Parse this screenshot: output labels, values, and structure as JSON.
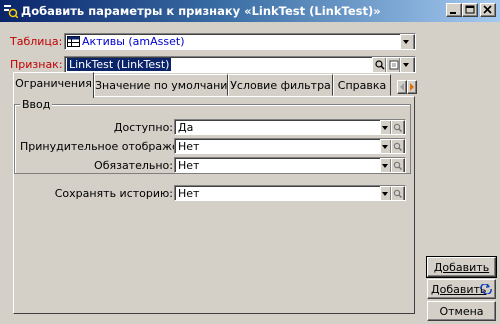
{
  "window": {
    "title": "Добавить параметры к признаку «LinkTest (LinkTest)»",
    "icon": "fields-icon",
    "controls": [
      "minimize",
      "maximize",
      "close"
    ]
  },
  "form": {
    "table_label": "Таблица:",
    "table_value": "Активы (amAsset)",
    "attribute_label": "Признак:",
    "attribute_value": "LinkTest (LinkTest)"
  },
  "tabs": [
    {
      "label": "Ограничения",
      "active": true
    },
    {
      "label": "Значение по умолчанию",
      "active": false
    },
    {
      "label": "Условие фильтра",
      "active": false
    },
    {
      "label": "Справка",
      "active": false
    }
  ],
  "group": {
    "legend": "Ввод",
    "rows": [
      {
        "label": "Доступно:",
        "value": "Да"
      },
      {
        "label": "Принудительное отображение:",
        "value": "Нет"
      },
      {
        "label": "Обязательно:",
        "value": "Нет"
      }
    ]
  },
  "history": {
    "label": "Сохранять историю:",
    "value": "Нет"
  },
  "buttons": {
    "add": "Добавить",
    "add_more": "Добавить",
    "cancel": "Отмена"
  },
  "colors": {
    "titlebar_start": "#0a246a",
    "titlebar_end": "#a6caf0",
    "required_label": "#c00000",
    "selection": "#0a246a",
    "link_text": "#0000cc"
  }
}
